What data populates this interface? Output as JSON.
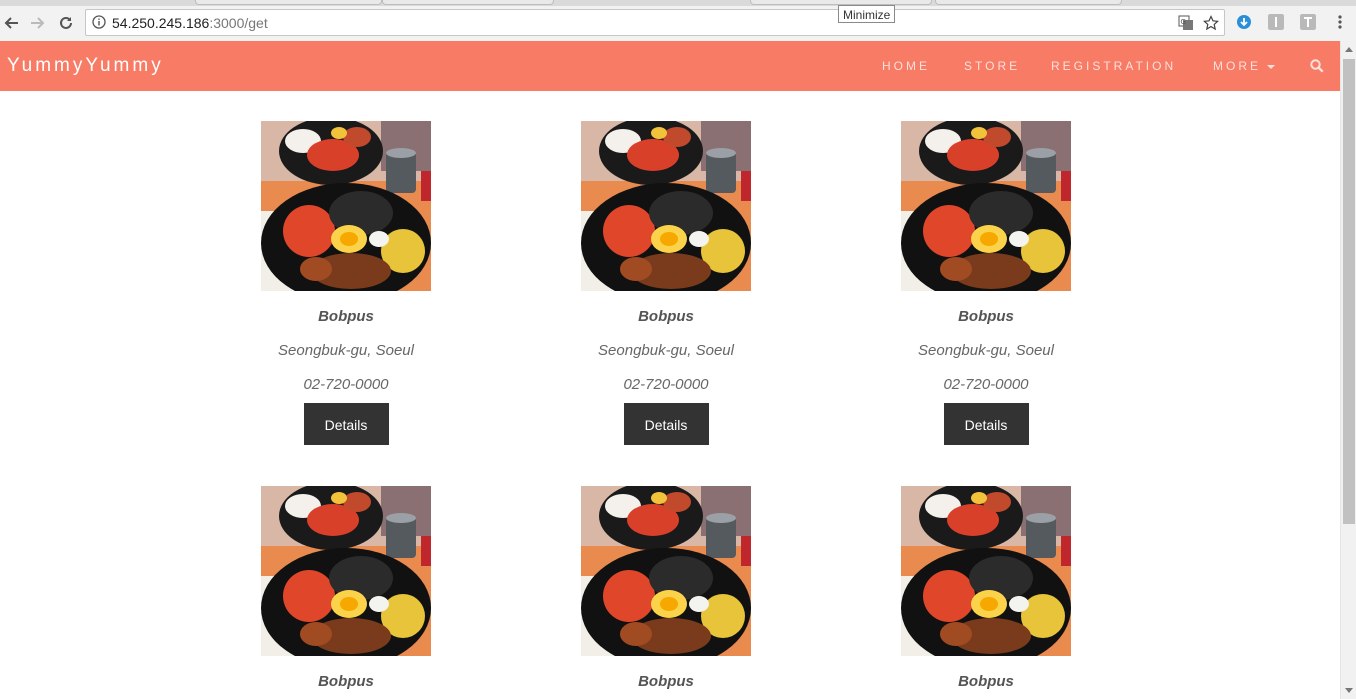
{
  "browser": {
    "url_host": "54.250.245.186",
    "url_path": ":3000/get",
    "tooltip": "Minimize",
    "icons": [
      "back-icon",
      "forward-icon",
      "reload-icon",
      "info-icon",
      "translate-icon",
      "star-icon",
      "download-ext-icon",
      "ext-i-icon",
      "ext-t-icon",
      "menu-icon"
    ]
  },
  "site": {
    "brand": "YummyYummy",
    "nav": [
      "HOME",
      "STORE",
      "REGISTRATION",
      "MORE"
    ],
    "navbar_color": "#f77b65"
  },
  "cards": [
    {
      "name": "Bobpus",
      "address": "Seongbuk-gu, Soeul",
      "phone": "02-720-0000",
      "button": "Details"
    },
    {
      "name": "Bobpus",
      "address": "Seongbuk-gu, Soeul",
      "phone": "02-720-0000",
      "button": "Details"
    },
    {
      "name": "Bobpus",
      "address": "Seongbuk-gu, Soeul",
      "phone": "02-720-0000",
      "button": "Details"
    },
    {
      "name": "Bobpus",
      "address": "",
      "phone": "",
      "button": ""
    },
    {
      "name": "Bobpus",
      "address": "",
      "phone": "",
      "button": ""
    },
    {
      "name": "Bobpus",
      "address": "",
      "phone": "",
      "button": ""
    }
  ]
}
